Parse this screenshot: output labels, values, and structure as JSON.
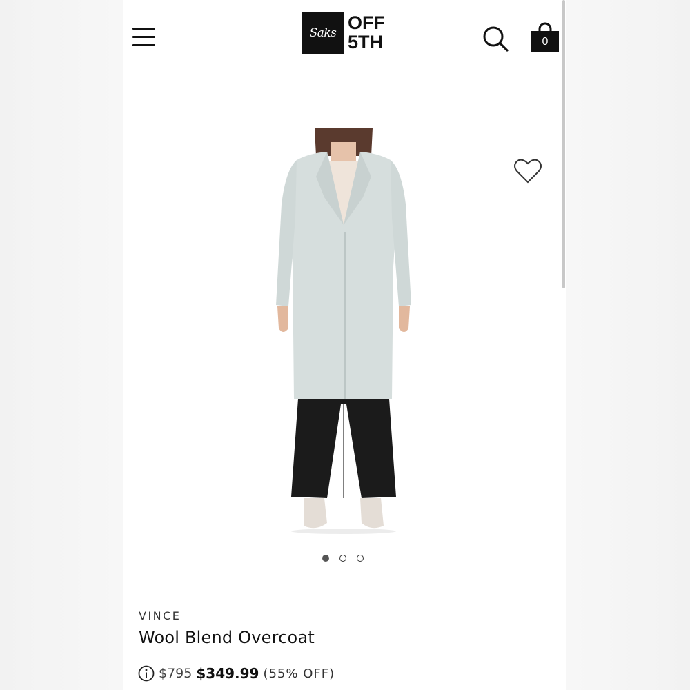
{
  "header": {
    "menu_icon": "hamburger-menu-icon",
    "logo": {
      "script_text": "Saks",
      "line1": "OFF",
      "line2": "5TH"
    },
    "search_icon": "search-icon",
    "bag_icon": "shopping-bag-icon",
    "bag_count": "0"
  },
  "product": {
    "image_description": "model wearing light grey-blue wool blend overcoat with black trousers",
    "wishlist_icon": "heart-outline-icon",
    "carousel": {
      "image_count": 3,
      "active_index": 0
    },
    "brand": "VINCE",
    "name": "Wool Blend Overcoat",
    "pricing": {
      "info_icon": "info-circle-icon",
      "original_price": "$795",
      "sale_price": "$349.99",
      "discount": "(55% OFF)"
    }
  },
  "colors": {
    "text_primary": "#111111",
    "coat": "#d5dcdb",
    "trousers": "#1a1a1a",
    "background": "#ffffff"
  }
}
